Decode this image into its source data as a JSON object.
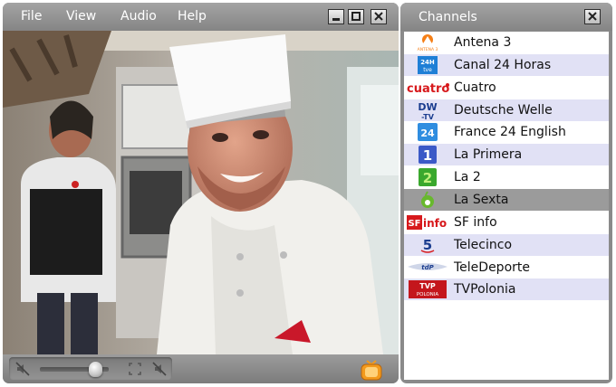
{
  "menu": {
    "file": "File",
    "view": "View",
    "audio": "Audio",
    "help": "Help"
  },
  "window_buttons": {
    "minimize": "minimize-icon",
    "maximize": "maximize-icon",
    "close": "close-icon"
  },
  "controls": {
    "volume_level": 0.8,
    "icons": [
      "mute-icon",
      "volume-slider",
      "fullscreen-icon",
      "speaker-off-icon",
      "tv-icon"
    ]
  },
  "channels": {
    "title": "Channels",
    "selected": "La Sexta",
    "items": [
      {
        "name": "Antena 3",
        "logo": "antena3-logo-icon",
        "logo_text": "ANTENA 3"
      },
      {
        "name": "Canal 24 Horas",
        "logo": "canal24h-logo-icon",
        "logo_text": "24H tve"
      },
      {
        "name": "Cuatro",
        "logo": "cuatro-logo-icon",
        "logo_text": "cuatro"
      },
      {
        "name": "Deutsche Welle",
        "logo": "dw-logo-icon",
        "logo_text": "DW-TV"
      },
      {
        "name": "France 24 English",
        "logo": "france24-logo-icon",
        "logo_text": "24"
      },
      {
        "name": "La Primera",
        "logo": "la-primera-logo-icon",
        "logo_text": "1"
      },
      {
        "name": "La 2",
        "logo": "la2-logo-icon",
        "logo_text": "2"
      },
      {
        "name": "La Sexta",
        "logo": "lasexta-logo-icon",
        "logo_text": "6"
      },
      {
        "name": "SF info",
        "logo": "sfinfo-logo-icon",
        "logo_text": "SF info"
      },
      {
        "name": "Telecinco",
        "logo": "telecinco-logo-icon",
        "logo_text": "5"
      },
      {
        "name": "TeleDeporte",
        "logo": "teledeporte-logo-icon",
        "logo_text": "tdP"
      },
      {
        "name": "TVPolonia",
        "logo": "tvpolonia-logo-icon",
        "logo_text": "TVP POLONIA"
      }
    ]
  },
  "colors": {
    "chrome": "#8a8a8a",
    "row_alt": "#e1e1f5",
    "row_selected": "#9b9b9b",
    "accent_orange": "#f39a1c"
  }
}
